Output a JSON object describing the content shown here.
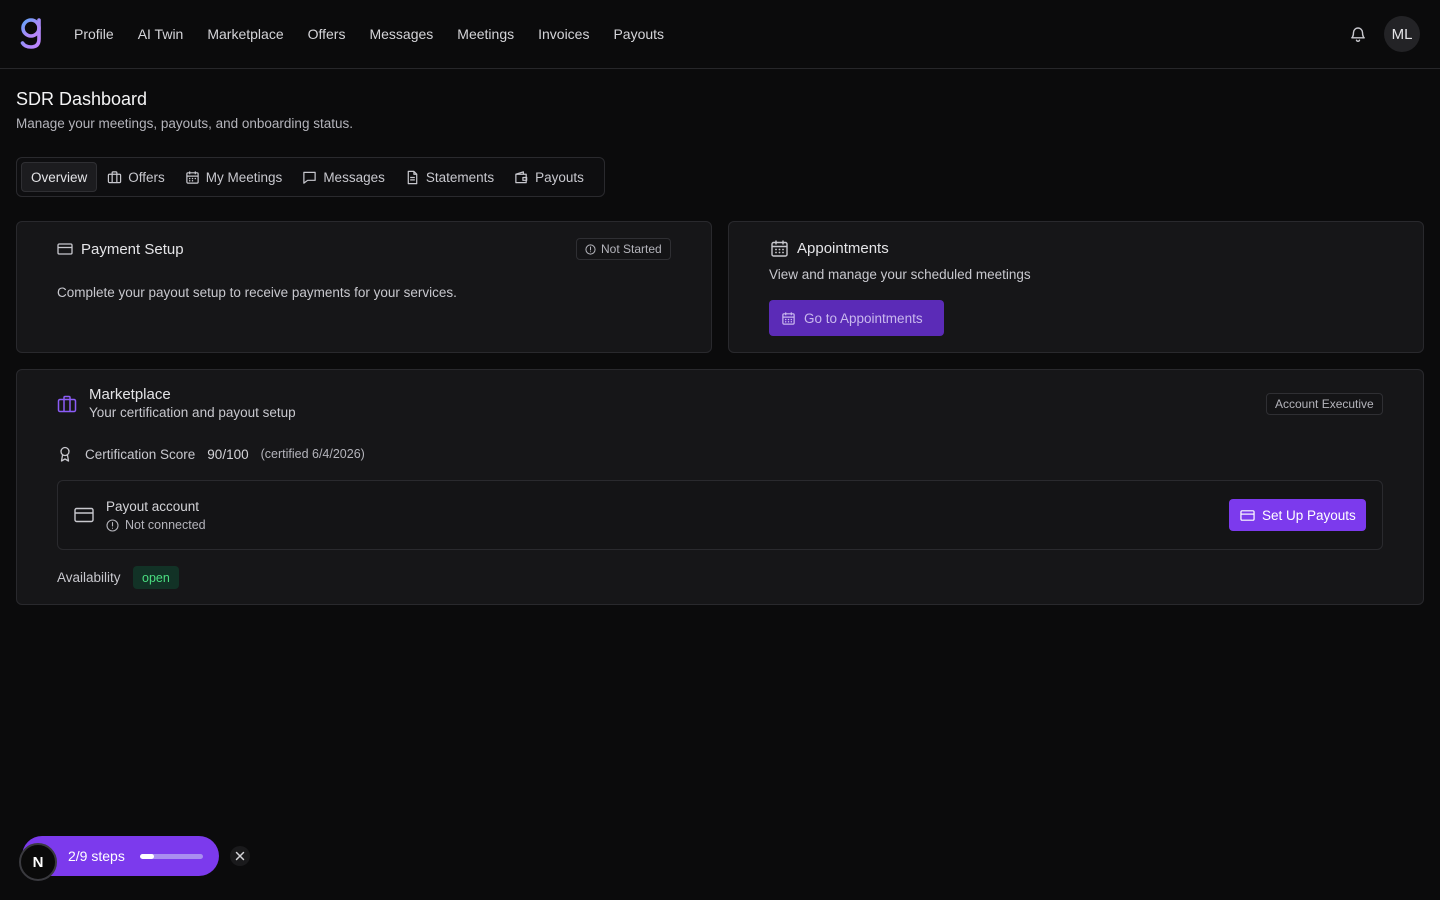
{
  "header": {
    "nav": [
      "Profile",
      "AI Twin",
      "Marketplace",
      "Offers",
      "Messages",
      "Meetings",
      "Invoices",
      "Payouts"
    ],
    "avatar_initials": "ML"
  },
  "page": {
    "title": "SDR Dashboard",
    "subtitle": "Manage your meetings, payouts, and onboarding status."
  },
  "tabs": [
    {
      "label": "Overview",
      "icon": "none",
      "active": true
    },
    {
      "label": "Offers",
      "icon": "briefcase-icon"
    },
    {
      "label": "My Meetings",
      "icon": "calendar-icon"
    },
    {
      "label": "Messages",
      "icon": "message-icon"
    },
    {
      "label": "Statements",
      "icon": "document-icon"
    },
    {
      "label": "Payouts",
      "icon": "wallet-icon"
    }
  ],
  "payment_setup": {
    "title": "Payment Setup",
    "status": "Not Started",
    "description": "Complete your payout setup to receive payments for your services."
  },
  "appointments": {
    "title": "Appointments",
    "description": "View and manage your scheduled meetings",
    "button": "Go to Appointments"
  },
  "marketplace": {
    "title": "Marketplace",
    "subtitle": "Your certification and payout setup",
    "role_badge": "Account Executive",
    "cert_label": "Certification Score",
    "cert_score": "90/100",
    "cert_date": "(certified 6/4/2026)",
    "payout_title": "Payout account",
    "payout_status": "Not connected",
    "setup_button": "Set Up Payouts",
    "availability_label": "Availability",
    "availability_value": "open"
  },
  "onboarding": {
    "steps_label": "2/9 steps",
    "progress": 0.22,
    "badge_letter": "N"
  },
  "colors": {
    "accent": "#7c3aed",
    "background": "#0b0b0c",
    "card": "#161618",
    "success": "#4ade80"
  }
}
